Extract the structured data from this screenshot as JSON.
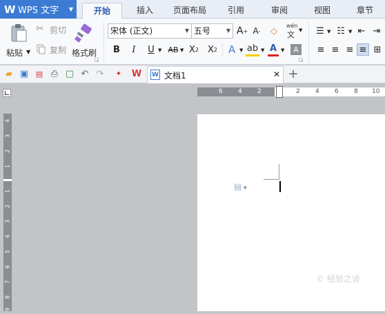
{
  "app": {
    "title": "WPS 文字",
    "logo": "W"
  },
  "menu_tabs": [
    {
      "label": "开始",
      "active": true
    },
    {
      "label": "插入"
    },
    {
      "label": "页面布局"
    },
    {
      "label": "引用"
    },
    {
      "label": "审阅"
    },
    {
      "label": "视图"
    },
    {
      "label": "章节"
    }
  ],
  "ribbon": {
    "paste": "粘贴",
    "cut": "剪切",
    "copy": "复制",
    "format_painter": "格式刷",
    "font_name": "宋体 (正文)",
    "font_size": "五号",
    "pinyin_top": "wén",
    "pinyin_bottom": "文"
  },
  "document": {
    "tab_title": "文档1"
  },
  "hruler_ticks": [
    "6",
    "4",
    "2",
    "2",
    "4",
    "6",
    "8",
    "10"
  ],
  "vruler_ticks": [
    "4",
    "3",
    "2",
    "1",
    "1",
    "2",
    "3",
    "4",
    "5",
    "6",
    "7",
    "8",
    "9"
  ],
  "watermark": "© 经验之谈",
  "colors": {
    "brand": "#3b7bd3",
    "active_tab_text": "#2a5cb0",
    "font_color": "#e02020",
    "highlight": "#f5d000"
  }
}
